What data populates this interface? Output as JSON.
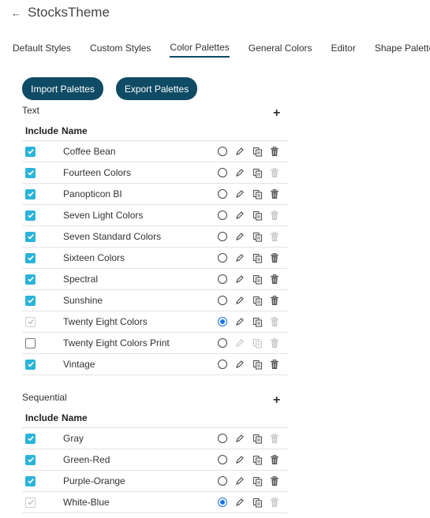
{
  "header": {
    "title": "StocksTheme",
    "back_icon": "arrow-left-icon"
  },
  "tabs": [
    {
      "label": "Default Styles"
    },
    {
      "label": "Custom Styles"
    },
    {
      "label": "Color Palettes",
      "active": true
    },
    {
      "label": "General Colors"
    },
    {
      "label": "Editor"
    },
    {
      "label": "Shape Palettes"
    }
  ],
  "buttons": {
    "import_label": "Import Palettes",
    "export_label": "Export Palettes"
  },
  "columns": {
    "include": "Include",
    "name": "Name"
  },
  "sections": [
    {
      "title": "Text",
      "rows": [
        {
          "name": "Coffee Bean",
          "include": "checked",
          "selected": false,
          "edit_enabled": true,
          "delete_enabled": true
        },
        {
          "name": "Fourteen Colors",
          "include": "checked",
          "selected": false,
          "edit_enabled": true,
          "delete_enabled": false
        },
        {
          "name": "Panopticon BI",
          "include": "checked",
          "selected": false,
          "edit_enabled": true,
          "delete_enabled": true
        },
        {
          "name": "Seven Light Colors",
          "include": "checked",
          "selected": false,
          "edit_enabled": true,
          "delete_enabled": false
        },
        {
          "name": "Seven Standard Colors",
          "include": "checked",
          "selected": false,
          "edit_enabled": true,
          "delete_enabled": false
        },
        {
          "name": "Sixteen Colors",
          "include": "checked",
          "selected": false,
          "edit_enabled": true,
          "delete_enabled": true
        },
        {
          "name": "Spectral",
          "include": "checked",
          "selected": false,
          "edit_enabled": true,
          "delete_enabled": true
        },
        {
          "name": "Sunshine",
          "include": "checked",
          "selected": false,
          "edit_enabled": true,
          "delete_enabled": true
        },
        {
          "name": "Twenty Eight Colors",
          "include": "disabled",
          "selected": true,
          "edit_enabled": true,
          "delete_enabled": false
        },
        {
          "name": "Twenty Eight Colors Print",
          "include": "unchecked",
          "selected": false,
          "edit_enabled": false,
          "delete_enabled": false
        },
        {
          "name": "Vintage",
          "include": "checked",
          "selected": false,
          "edit_enabled": true,
          "delete_enabled": true
        }
      ]
    },
    {
      "title": "Sequential",
      "rows": [
        {
          "name": "Gray",
          "include": "checked",
          "selected": false,
          "edit_enabled": true,
          "delete_enabled": false
        },
        {
          "name": "Green-Red",
          "include": "checked",
          "selected": false,
          "edit_enabled": true,
          "delete_enabled": true
        },
        {
          "name": "Purple-Orange",
          "include": "checked",
          "selected": false,
          "edit_enabled": true,
          "delete_enabled": true
        },
        {
          "name": "White-Blue",
          "include": "disabled",
          "selected": true,
          "edit_enabled": true,
          "delete_enabled": false
        }
      ]
    }
  ],
  "colors": {
    "button_bg": "#0f4b64",
    "tab_active": "#0f4b64",
    "checkbox_on": "#2bb4d9",
    "radio_selected": "#1a73e8",
    "icon_default": "#555555",
    "icon_disabled": "#c8c8c8"
  }
}
